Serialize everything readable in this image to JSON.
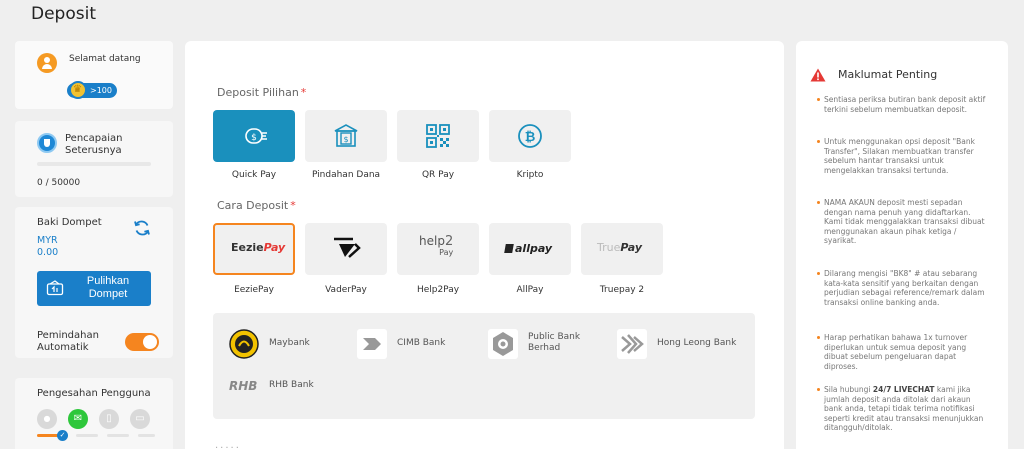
{
  "page": {
    "title": "Deposit"
  },
  "welcome": {
    "greeting": "Selamat datang",
    "level": ">100"
  },
  "achievement": {
    "label": "Pencapaian Seterusnya",
    "value": "0 / 50000",
    "progress": 0
  },
  "wallet": {
    "label": "Baki Dompet",
    "currency": "MYR",
    "amount": "0.00",
    "restore_label": "Pulihkan Dompet"
  },
  "auto_transfer": {
    "label": "Pemindahan Automatik",
    "enabled": true
  },
  "verification": {
    "label": "Pengesahan Pengguna"
  },
  "deposit_options": {
    "label": "Deposit Pilihan",
    "required": "*",
    "items": [
      {
        "label": "Quick Pay",
        "icon": "quick-pay-icon",
        "selected": true
      },
      {
        "label": "Pindahan Dana",
        "icon": "bank-transfer-icon",
        "selected": false
      },
      {
        "label": "QR Pay",
        "icon": "qr-code-icon",
        "selected": false
      },
      {
        "label": "Kripto",
        "icon": "bitcoin-icon",
        "selected": false
      }
    ]
  },
  "deposit_methods": {
    "label": "Cara Deposit",
    "required": "*",
    "items": [
      {
        "label": "EeziePay",
        "logo_text_a": "Eezie",
        "logo_text_b": "Pay",
        "selected": true
      },
      {
        "label": "VaderPay",
        "selected": false
      },
      {
        "label": "Help2Pay",
        "logo_text_a": "help",
        "logo_text_b": "2",
        "logo_text_c": "Pay",
        "selected": false
      },
      {
        "label": "AllPay",
        "logo_text": "allpay",
        "selected": false
      },
      {
        "label": "Truepay 2",
        "logo_text_a": "True",
        "logo_text_b": "Pay",
        "selected": false
      }
    ]
  },
  "banks": [
    {
      "name": "Maybank"
    },
    {
      "name": "CIMB Bank"
    },
    {
      "name": "Public Bank Berhad"
    },
    {
      "name": "Hong Leong Bank"
    },
    {
      "name": "RHB Bank",
      "logo_text": "RHB"
    }
  ],
  "info": {
    "title": "Maklumat Penting",
    "notices": [
      "Sentiasa periksa butiran bank deposit aktif terkini sebelum membuatkan deposit.",
      "Untuk menggunakan opsi deposit \"Bank Transfer\", Silakan membuatkan transfer sebelum hantar transaksi untuk mengelakkan transaksi tertunda.",
      "NAMA AKAUN deposit mesti sepadan dengan nama penuh yang didaftarkan. Kami tidak menggalakkan transaksi dibuat menggunakan akaun pihak ketiga / syarikat.",
      "Dilarang mengisi \"BK8\" # atau sebarang kata-kata sensitif yang berkaitan dengan perjudian sebagai reference/remark dalam transaksi online banking anda.",
      "Harap perhatikan bahawa 1x turnover diperlukan untuk semua deposit yang dibuat sebelum pengeluaran dapat diproses."
    ],
    "livechat_pre": "Sila hubungi ",
    "livechat_bold": "24/7 LIVECHAT",
    "livechat_post": " kami jika jumlah deposit anda ditolak dari akaun bank anda, tetapi tidak terima notifikasi seperti kredit atau transaksi menunjukkan ditangguh/ditolak."
  },
  "colors": {
    "accent": "#1a7fc9",
    "selected_tile": "#1a90bd",
    "orange": "#f5851f",
    "warning": "#e53935"
  }
}
